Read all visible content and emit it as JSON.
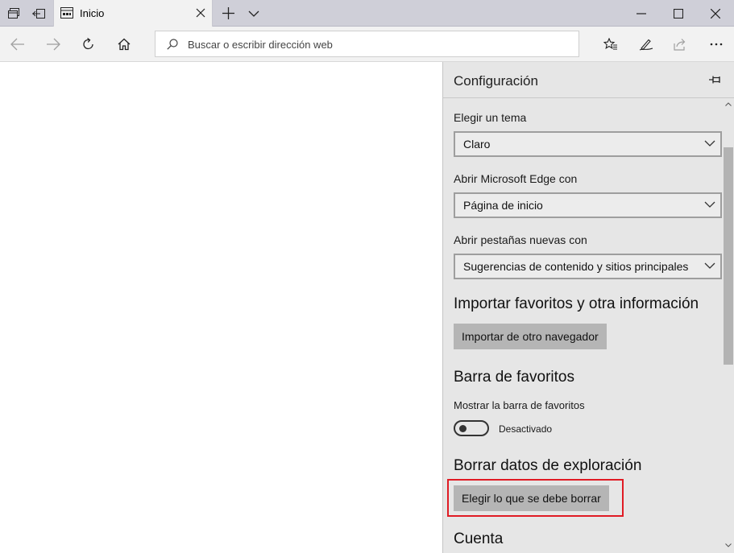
{
  "tab": {
    "title": "Inicio"
  },
  "address_bar": {
    "placeholder": "Buscar o escribir dirección web"
  },
  "settings": {
    "title": "Configuración",
    "theme": {
      "label": "Elegir un tema",
      "value": "Claro"
    },
    "open_with": {
      "label": "Abrir Microsoft Edge con",
      "value": "Página de inicio"
    },
    "new_tabs": {
      "label": "Abrir pestañas nuevas con",
      "value": "Sugerencias de contenido y sitios principales"
    },
    "import": {
      "heading": "Importar favoritos y otra información",
      "button": "Importar de otro navegador"
    },
    "favorites_bar": {
      "heading": "Barra de favoritos",
      "label": "Mostrar la barra de favoritos",
      "state": "Desactivado",
      "enabled": false
    },
    "clear_data": {
      "heading": "Borrar datos de exploración",
      "button": "Elegir lo que se debe borrar"
    },
    "account": {
      "heading": "Cuenta"
    }
  },
  "colors": {
    "highlight": "#e01b24",
    "panel_bg": "#e6e6e6",
    "tabbar_bg": "#cfcfd8"
  },
  "icons": [
    "tab-set-aside-icon",
    "show-tabs-icon",
    "tab-page-icon",
    "close-icon",
    "new-tab-icon",
    "chevron-down-icon",
    "minimize-icon",
    "maximize-icon",
    "window-close-icon",
    "back-arrow-icon",
    "forward-arrow-icon",
    "refresh-icon",
    "home-icon",
    "search-icon",
    "favorites-icon",
    "pen-icon",
    "share-icon",
    "more-icon",
    "pin-icon"
  ]
}
